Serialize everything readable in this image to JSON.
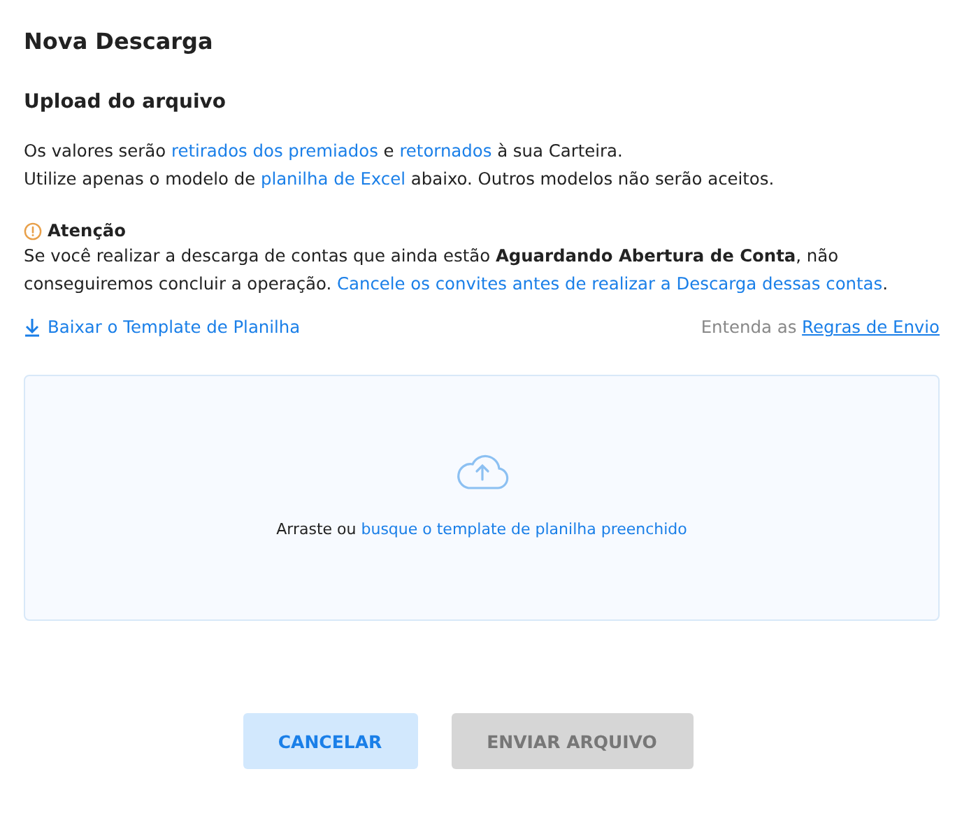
{
  "title": "Nova Descarga",
  "subtitle": "Upload do arquivo",
  "intro": [
    [
      {
        "kind": "text",
        "text": "Os valores serão "
      },
      {
        "kind": "link",
        "text": "retirados dos premiados"
      },
      {
        "kind": "text",
        "text": " e "
      },
      {
        "kind": "link",
        "text": "retornados"
      },
      {
        "kind": "text",
        "text": " à sua Carteira."
      }
    ],
    [
      {
        "kind": "text",
        "text": "Utilize apenas o modelo de "
      },
      {
        "kind": "link",
        "text": "planilha de Excel"
      },
      {
        "kind": "text",
        "text": " abaixo. Outros modelos não serão aceitos."
      }
    ]
  ],
  "warning": {
    "title": "Atenção",
    "body": [
      {
        "kind": "text",
        "text": "Se você realizar a descarga de contas que ainda estão "
      },
      {
        "kind": "bold",
        "text": "Aguardando Abertura de Conta"
      },
      {
        "kind": "text",
        "text": ", não conseguiremos concluir a operação. "
      },
      {
        "kind": "link",
        "text": "Cancele os convites antes de realizar a Descarga dessas contas"
      },
      {
        "kind": "text",
        "text": "."
      }
    ]
  },
  "download_link": "Baixar o Template de Planilha",
  "rules": {
    "prefix": "Entenda as",
    "link": "Regras de Envio"
  },
  "dropzone": {
    "prefix": "Arraste ou",
    "link": "busque o template de planilha preenchido"
  },
  "buttons": [
    {
      "label": "CANCELAR",
      "kind": "secondary",
      "disabled": false
    },
    {
      "label": "ENVIAR ARQUIVO",
      "kind": "primary",
      "disabled": true
    }
  ]
}
